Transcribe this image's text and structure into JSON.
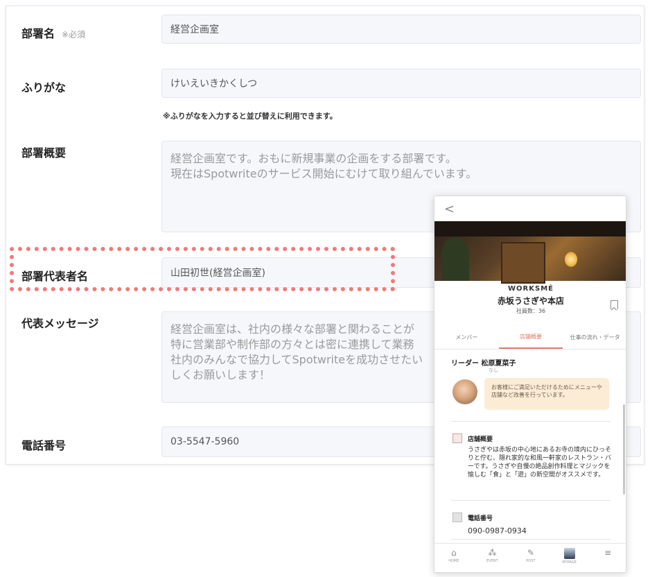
{
  "form": {
    "dept_name": {
      "label": "部署名",
      "required": "※必須",
      "value": "経営企画室"
    },
    "furigana": {
      "label": "ふりがな",
      "value": "けいえいきかくしつ",
      "hint": "※ふりがなを入力すると並び替えに利用できます。"
    },
    "summary": {
      "label": "部署概要",
      "value": "経営企画室です。おもに新規事業の企画をする部署です。\n現在はSpotwriteのサービス開始にむけて取り組んでいます。"
    },
    "representative": {
      "label": "部署代表者名",
      "value": "山田初世(経営企画室)"
    },
    "message": {
      "label": "代表メッセージ",
      "value": "経営企画室は、社内の様々な部署と関わることが\n特に営業部や制作部の方々とは密に連携して業務\n社内のみんなで協力してSpotwriteを成功させたい\nしくお願いします！"
    },
    "phone": {
      "label": "電話番号",
      "value": "03-5547-5960"
    }
  },
  "phone_preview": {
    "back": "<",
    "brand": "WORKSMÉ",
    "shop_name": "赤坂うさぎや本店",
    "staff_count": "社員数：36",
    "tabs": [
      "メンバー",
      "店舗概要",
      "仕事の流れ・データ"
    ],
    "active_tab": "店舗概要",
    "leader": "リーダー 松原夏菜子",
    "leader_sub": "なし",
    "leader_message": "お客様にご満足いただけるためにメニューや店舗など改善を行っています。",
    "section_overview_title": "店舗概要",
    "section_overview_body": "うさぎやは赤坂の中心地にあるお寺の境内にひっそりと佇む、隠れ家的な和風一軒家のレストラン・バーです。うさぎや自慢の絶品創作料理とマジックを愉しむ「食」と「遊」の新空間がオススメです。",
    "section_tel_title": "電話番号",
    "section_tel_value": "090-0987-0934",
    "nav": [
      {
        "label": "HOME",
        "icon": "home-icon"
      },
      {
        "label": "EVENT",
        "icon": "event-icon"
      },
      {
        "label": "POST",
        "icon": "post-icon"
      },
      {
        "label": "MYPAGE",
        "icon": "mypage-avatar-icon"
      },
      {
        "label": "",
        "icon": "menu-icon"
      }
    ]
  }
}
